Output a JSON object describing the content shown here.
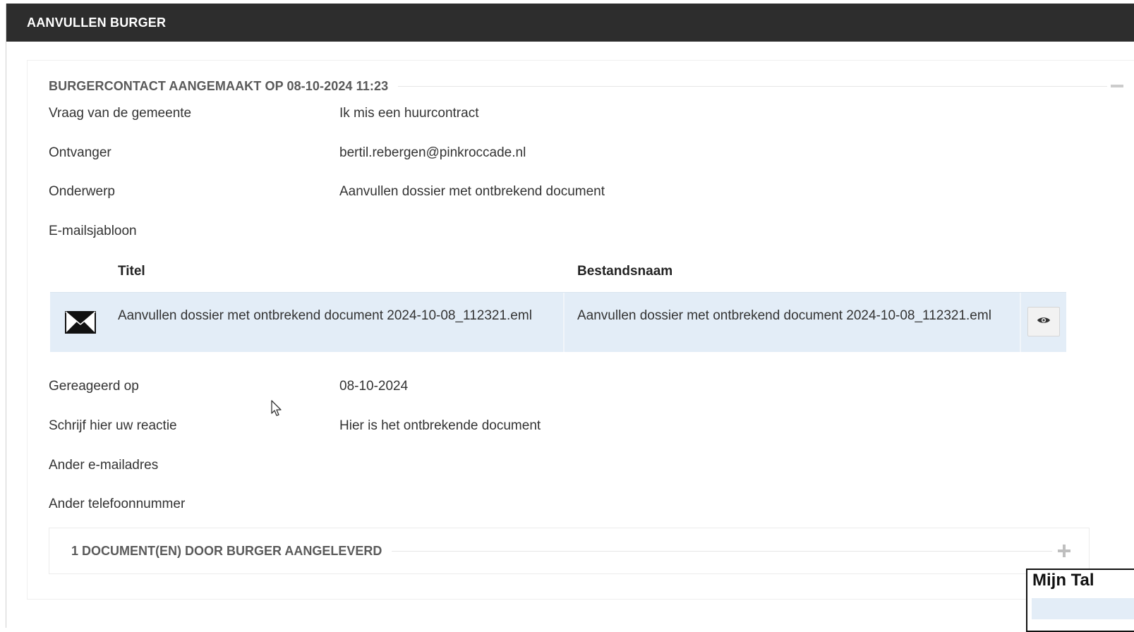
{
  "header": {
    "title": "AANVULLEN BURGER"
  },
  "contact": {
    "section_title": "BURGERCONTACT AANGEMAAKT OP 08-10-2024 11:23",
    "fields": [
      {
        "label": "Vraag van de gemeente",
        "value": "Ik mis een huurcontract"
      },
      {
        "label": "Ontvanger",
        "value": "bertil.rebergen@pinkroccade.nl"
      },
      {
        "label": "Onderwerp",
        "value": "Aanvullen dossier met ontbrekend document"
      },
      {
        "label": "E-mailsjabloon",
        "value": ""
      }
    ],
    "table": {
      "headers": {
        "title": "Titel",
        "filename": "Bestandsnaam"
      },
      "rows": [
        {
          "icon": "envelope-icon",
          "title": "Aanvullen dossier met ontbrekend document 2024-10-08_112321.eml",
          "filename": "Aanvullen dossier met ontbrekend document 2024-10-08_112321.eml",
          "action_icon": "eye-icon"
        }
      ]
    },
    "fields_after": [
      {
        "label": "Gereageerd op",
        "value": "08-10-2024"
      },
      {
        "label": "Schrijf hier uw reactie",
        "value": "Hier is het ontbrekende document"
      },
      {
        "label": "Ander e-mailadres",
        "value": ""
      },
      {
        "label": "Ander telefoonnummer",
        "value": ""
      }
    ],
    "documents_panel": {
      "title": "1 DOCUMENT(EN) DOOR BURGER AANGELEVERD"
    }
  },
  "popup": {
    "title": "Mijn Tal"
  },
  "colors": {
    "header_bg": "#2d2d2d",
    "row_highlight": "#e3edf7"
  }
}
